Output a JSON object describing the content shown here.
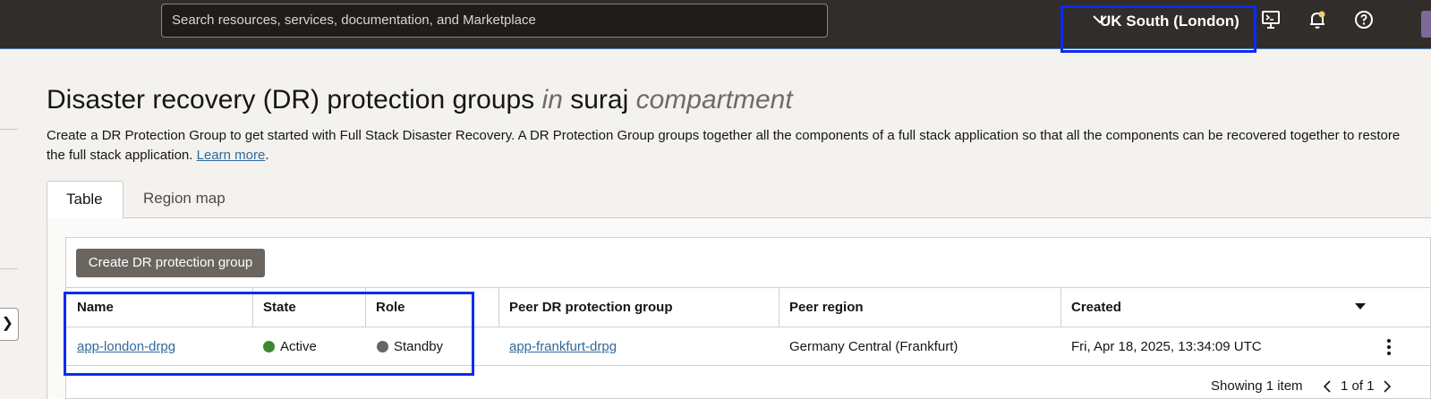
{
  "header": {
    "search_placeholder": "Search resources, services, documentation, and Marketplace",
    "region": "UK South (London)",
    "icons": [
      "chevron-down-icon",
      "cloud-shell-icon",
      "bell-icon",
      "help-icon"
    ]
  },
  "page": {
    "title_main": "Disaster recovery (DR) protection groups",
    "title_in": "in",
    "title_compartment_name": "suraj",
    "title_compartment_word": "compartment",
    "description": "Create a DR Protection Group to get started with Full Stack Disaster Recovery. A DR Protection Group groups together all the components of a full stack application so that all the components can be recovered together to restore the full stack application.",
    "learn_more": "Learn more",
    "description_end": "."
  },
  "tabs": [
    {
      "label": "Table",
      "active": true
    },
    {
      "label": "Region map",
      "active": false
    }
  ],
  "toolbar": {
    "create_button": "Create DR protection group"
  },
  "table": {
    "columns": [
      "Name",
      "State",
      "Role",
      "Peer DR protection group",
      "Peer region",
      "Created"
    ],
    "rows": [
      {
        "name": "app-london-drpg",
        "state": "Active",
        "role": "Standby",
        "peer_group": "app-frankfurt-drpg",
        "peer_region": "Germany Central (Frankfurt)",
        "created": "Fri, Apr 18, 2025, 13:34:09 UTC"
      }
    ],
    "footer": {
      "showing": "Showing 1 item",
      "page": "1 of 1"
    }
  },
  "colors": {
    "active": "#3c8a2e",
    "standby": "#6b6560",
    "highlight": "#0a2cf0",
    "topbar": "#312d2a"
  }
}
